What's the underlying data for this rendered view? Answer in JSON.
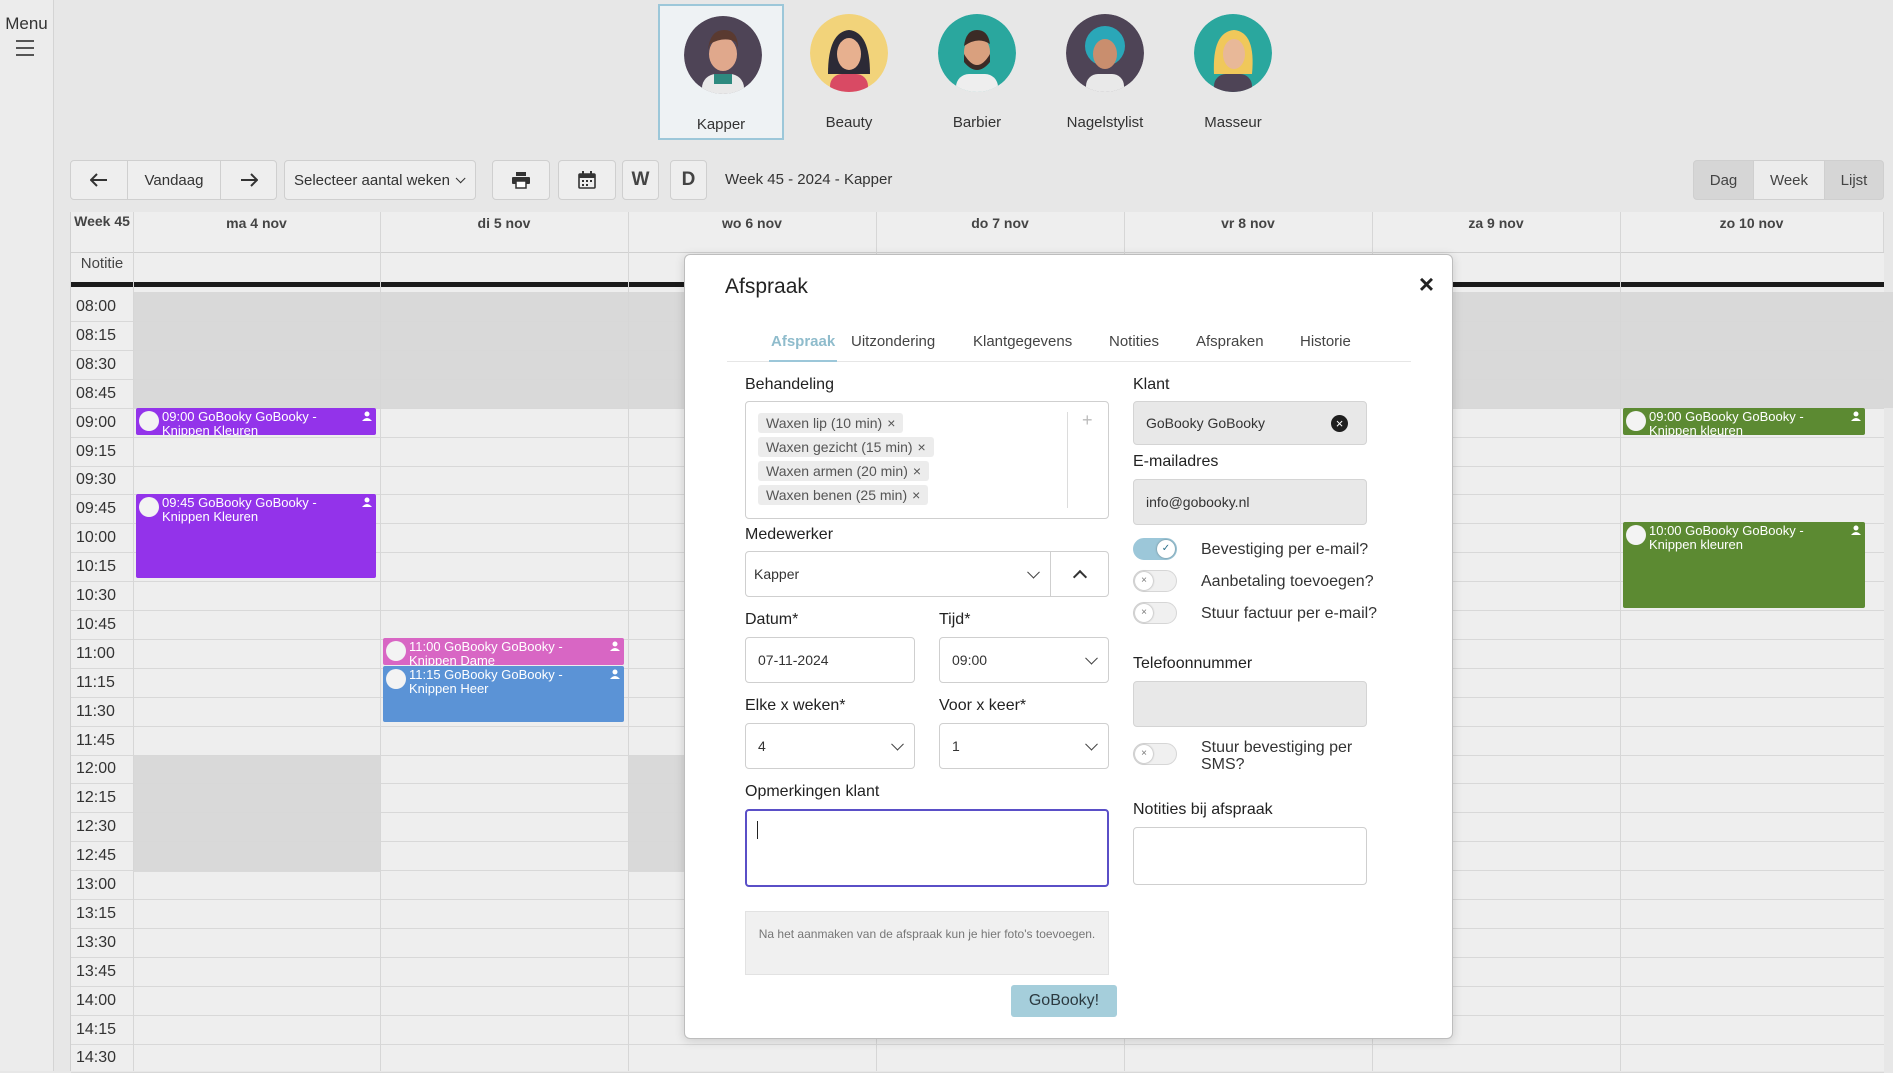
{
  "sidebar": {
    "menu_label": "Menu"
  },
  "categories": [
    {
      "name": "Kapper",
      "active": true
    },
    {
      "name": "Beauty",
      "active": false
    },
    {
      "name": "Barbier",
      "active": false
    },
    {
      "name": "Nagelstylist",
      "active": false
    },
    {
      "name": "Masseur",
      "active": false
    }
  ],
  "toolbar": {
    "today_label": "Vandaag",
    "weeks_select_label": "Selecteer aantal weken",
    "w_label": "W",
    "d_label": "D",
    "title": "Week 45 - 2024 - Kapper",
    "views": [
      "Dag",
      "Week",
      "Lijst"
    ]
  },
  "calendar": {
    "week_label": "Week 45",
    "notitie_label": "Notitie",
    "days": [
      "ma 4 nov",
      "di 5 nov",
      "wo 6 nov",
      "do 7 nov",
      "vr 8 nov",
      "za 9 nov",
      "zo 10 nov"
    ],
    "times": [
      "08:00",
      "08:15",
      "08:30",
      "08:45",
      "09:00",
      "09:15",
      "09:30",
      "09:45",
      "10:00",
      "10:15",
      "10:30",
      "10:45",
      "11:00",
      "11:15",
      "11:30",
      "11:45",
      "12:00",
      "12:15",
      "12:30",
      "12:45",
      "13:00",
      "13:15",
      "13:30",
      "13:45",
      "14:00",
      "14:15",
      "14:30"
    ],
    "appointments": [
      {
        "text": "09:00 GoBooky GoBooky - Knippen Kleuren",
        "color": "#9333ea"
      },
      {
        "text": "09:45 GoBooky GoBooky - Knippen Kleuren",
        "color": "#9333ea"
      },
      {
        "text": "11:00 GoBooky GoBooky - Knippen Dame",
        "color": "#d866c4"
      },
      {
        "text": "11:15 GoBooky GoBooky - Knippen Heer",
        "color": "#5b93d6"
      },
      {
        "text": "09:00 GoBooky GoBooky - Knippen kleuren",
        "color": "#5c8a32"
      },
      {
        "text": "10:00 GoBooky GoBooky - Knippen kleuren",
        "color": "#5c8a32"
      }
    ]
  },
  "modal": {
    "title": "Afspraak",
    "tabs": [
      "Afspraak",
      "Uitzondering",
      "Klantgegevens",
      "Notities",
      "Afspraken",
      "Historie"
    ],
    "behandeling_label": "Behandeling",
    "treatments": [
      "Waxen lip (10 min)",
      "Waxen gezicht (15 min)",
      "Waxen armen (20 min)",
      "Waxen benen (25 min)"
    ],
    "medewerker_label": "Medewerker",
    "medewerker_value": "Kapper",
    "datum_label": "Datum*",
    "datum_value": "07-11-2024",
    "tijd_label": "Tijd*",
    "tijd_value": "09:00",
    "elke_label": "Elke x weken*",
    "elke_value": "4",
    "voor_label": "Voor x keer*",
    "voor_value": "1",
    "opmerkingen_label": "Opmerkingen klant",
    "photo_note": "Na het aanmaken van de afspraak kun je hier foto's toevoegen.",
    "submit_label": "GoBooky!",
    "klant_label": "Klant",
    "klant_value": "GoBooky GoBooky",
    "email_label": "E-mailadres",
    "email_value": "info@gobooky.nl",
    "toggle_email_conf": "Bevestiging per e-mail?",
    "toggle_deposit": "Aanbetaling toevoegen?",
    "toggle_invoice": "Stuur factuur per e-mail?",
    "telefoon_label": "Telefoonnummer",
    "toggle_sms": "Stuur bevestiging per SMS?",
    "notities_label": "Notities bij afspraak"
  }
}
